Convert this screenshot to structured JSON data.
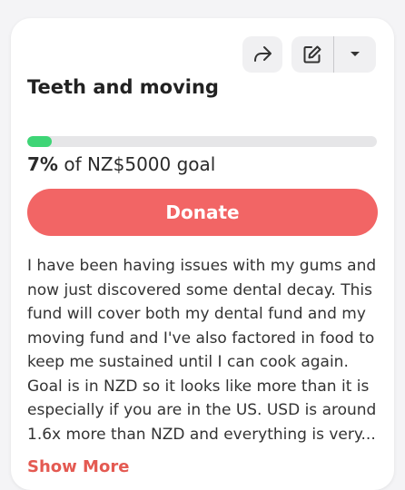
{
  "campaign": {
    "title": "Teeth and moving",
    "progress_percent": 7,
    "percent_label": "7%",
    "goal_text": " of NZ$5000 goal",
    "description": "I have been having issues with my gums and now just discovered some dental decay. This fund will cover both my dental fund and my moving fund and I've also factored in food to keep me sustained until I can cook again. Goal is in NZD so it looks like more than it is especially if you are in the US. USD is around 1.6x more than NZD and everything is very..."
  },
  "actions": {
    "donate_label": "Donate",
    "show_more_label": "Show More"
  },
  "icons": {
    "share": "share-arrow-icon",
    "edit": "edit-pencil-icon",
    "dropdown": "caret-down-icon"
  },
  "colors": {
    "progress": "#3ed576",
    "donate": "#f26565",
    "show_more": "#e45a52"
  }
}
